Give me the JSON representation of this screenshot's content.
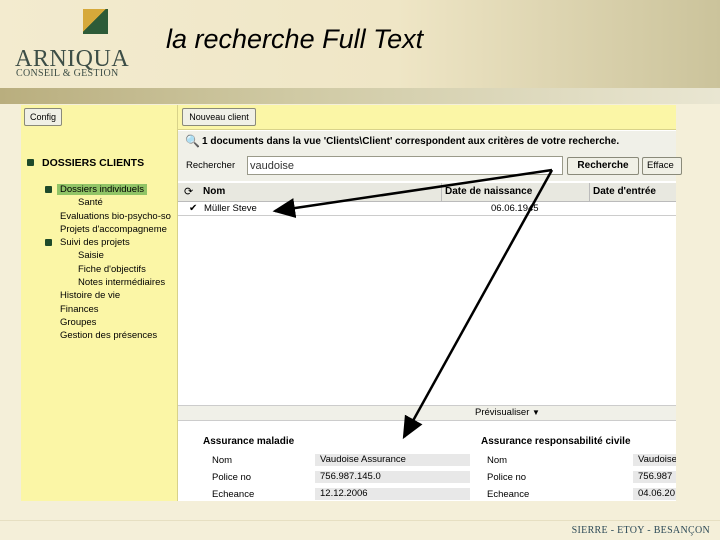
{
  "slide": {
    "title": "la recherche Full Text",
    "logo_name": "ARNIQUA",
    "logo_sub": "CONSEIL & GESTION",
    "footer": "SIERRE - ETOY - BESANÇON"
  },
  "app": {
    "config_label": "Config",
    "new_client_label": "Nouveau client",
    "tree": {
      "root": "DOSSIERS CLIENTS",
      "items": [
        {
          "label": "Dossiers individuels",
          "selected": true
        },
        {
          "label": "Santé"
        },
        {
          "label": "Evaluations bio-psycho-so"
        },
        {
          "label": "Projets d'accompagneme"
        },
        {
          "label": "Suivi des projets"
        },
        {
          "label": "Saisie"
        },
        {
          "label": "Fiche d'objectifs"
        },
        {
          "label": "Notes intermédiaires"
        },
        {
          "label": "Histoire de vie"
        },
        {
          "label": "Finances"
        },
        {
          "label": "Groupes"
        },
        {
          "label": "Gestion des présences"
        }
      ]
    },
    "info_text": "1 documents dans la vue 'Clients\\Client' correspondent aux critères de votre recherche.",
    "search": {
      "label": "Rechercher",
      "value": "vaudoise",
      "search_button": "Recherche",
      "clear_button": "Efface"
    },
    "grid": {
      "columns": [
        "Nom",
        "Date de naissance",
        "Date d'entrée"
      ],
      "rows": [
        {
          "nom": "Müller Steve",
          "naissance": "06.06.1945",
          "entree": ""
        }
      ]
    },
    "preview": {
      "toggle_label": "Prévisualiser",
      "left": {
        "title": "Assurance maladie",
        "fields": [
          {
            "label": "Nom",
            "value": "Vaudoise Assurance"
          },
          {
            "label": "Police no",
            "value": "756.987.145.0"
          },
          {
            "label": "Echeance",
            "value": "12.12.2006"
          }
        ]
      },
      "right": {
        "title": "Assurance responsabilité civile",
        "fields": [
          {
            "label": "Nom",
            "value": "Vaudoise"
          },
          {
            "label": "Police no",
            "value": "756.987"
          },
          {
            "label": "Echeance",
            "value": "04.06.20"
          }
        ]
      }
    }
  }
}
